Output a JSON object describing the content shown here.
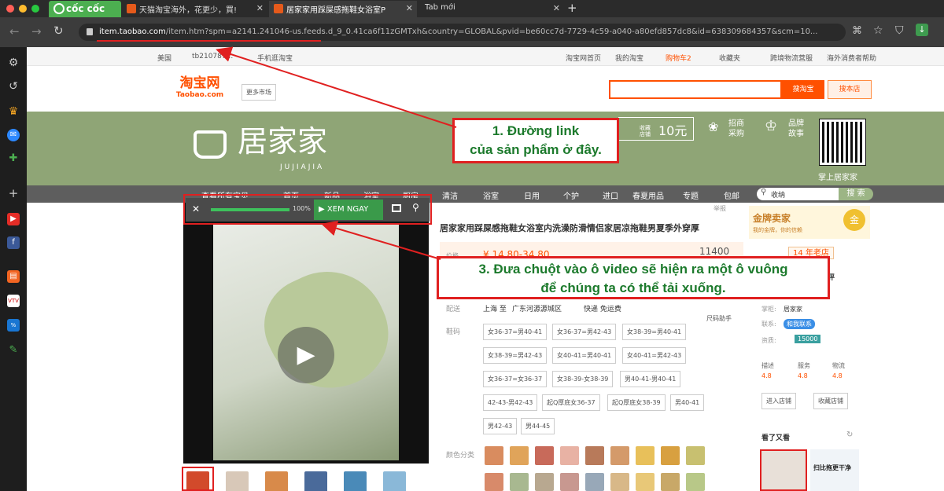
{
  "browser": {
    "brand": "cốc cốc",
    "tabs": [
      {
        "title": "天猫淘宝海外，花更少，買!",
        "active": false
      },
      {
        "title": "居家家用踩屎感拖鞋女浴室P",
        "active": true
      },
      {
        "title": "Tab mới",
        "active": false
      }
    ],
    "new_tab": "+",
    "url_host": "item.taobao.com",
    "url_rest": "/item.htm?spm=a2141.241046-us.feeds.d_9_0.41ca6f11zGMTxh&country=GLOBAL&pvid=be60cc7d-7729-4c59-a040-a80efd857dc8&id=638309684357&scm=10..."
  },
  "topbar": {
    "left": [
      "美国",
      "tb210787...",
      "手机逛淘宝"
    ],
    "right": [
      "淘宝网首页",
      "我的淘宝",
      "购物车2",
      "收藏夹",
      "跨境物流营服",
      "海外消费者帮助"
    ]
  },
  "header": {
    "logo_cn": "淘宝网",
    "logo_en": "Taobao.com",
    "market_btn": "更多市场",
    "search_btn": "搜淘宝",
    "store_btn": "搜本店"
  },
  "banner": {
    "brand_cn": "居家家",
    "brand_en": "JUJIAJIA",
    "coupon_label": "收藏店铺",
    "coupon_value": "10元",
    "zhaoshang": "招商 采购",
    "brand_story": "品牌 故事",
    "qr_caption": "掌上居家家"
  },
  "catnav": {
    "items": [
      "查看所有宝贝",
      "首页",
      "新品",
      "浴室",
      "厨房",
      "清洁",
      "浴室",
      "日用",
      "个护",
      "进口",
      "春夏用品",
      "专题",
      "包邮"
    ],
    "search_value": "收纳",
    "search_btn": "搜 索"
  },
  "video_bar": {
    "close": "✕",
    "percent": "100%",
    "cta": "XEM NGAY",
    "progress": 1.0
  },
  "product": {
    "title": "居家家用踩屎感拖鞋女浴室内洗澡防滑情侣家居凉拖鞋男夏季外穿厚",
    "report": "举报",
    "price_label": "价格",
    "price_value": "¥ 14.80-34.80",
    "sales": "11400",
    "ship_label": "配送",
    "ship_from": "上海 至",
    "ship_to": "广东河源源城区",
    "ship_method": "快递 免运费",
    "size_guide": "尺码助手",
    "size_label": "鞋码",
    "sizes": [
      "女36-37=男40-41",
      "女36-37=男42-43",
      "女38-39=男40-41",
      "女38-39=男42-43",
      "女40-41=男40-41",
      "女40-41=男42-43",
      "女36-37=女36-37",
      "女38-39-女38-39",
      "男40-41-男40-41",
      "42-43-男42-43",
      "起Q厚底女36-37",
      "起Q厚底女38-39",
      "男40-41",
      "男42-43",
      "男44-45"
    ],
    "color_label": "颜色分类"
  },
  "shop": {
    "gold_seller": "金牌卖家",
    "gold_sub": "我的金牌，你的信赖",
    "gold_medal": "金",
    "days_badge": "14 年老店",
    "partial": "评",
    "keeper_label": "掌柜:",
    "keeper": "居家家",
    "contact_label": "联系:",
    "contact": "和我联系",
    "qual_label": "资质:",
    "qual": "15000",
    "scores": [
      {
        "label": "描述",
        "val": "4.8"
      },
      {
        "label": "服务",
        "val": "4.8"
      },
      {
        "label": "物流",
        "val": "4.8"
      }
    ],
    "enter_btn": "进入店铺",
    "fav_btn": "收藏店铺",
    "seen_title": "看了又看",
    "rec_text": "扫比拖更干净"
  },
  "annotations": {
    "a1": "1. Đường link\ncủa sản phẩm ở đây.",
    "a3": "3. Đưa chuột vào ô video sẽ hiện ra một ô vuông\nđể chúng ta có thể tải xuống."
  },
  "colors": {
    "accent": "#ff5000",
    "annotation_red": "#e02020",
    "annotation_green": "#1c7a2c",
    "banner_green": "#8fa576"
  }
}
